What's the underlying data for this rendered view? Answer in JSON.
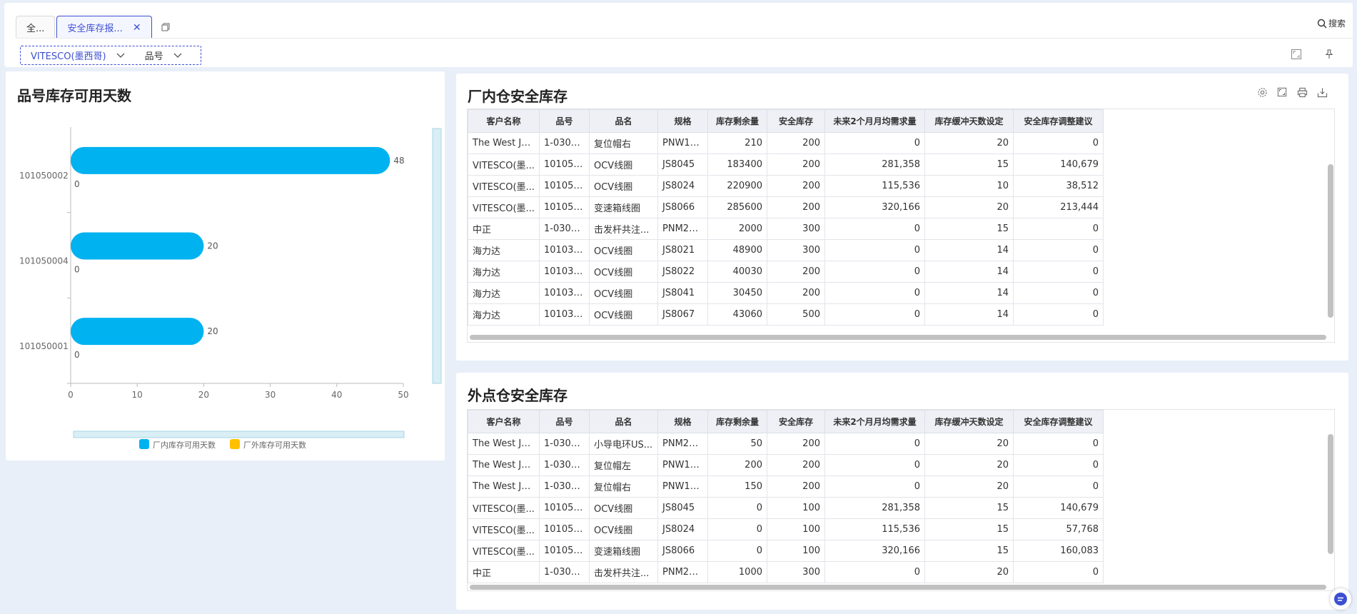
{
  "tabs": [
    {
      "label": "全..."
    },
    {
      "label": "安全库存报..."
    }
  ],
  "search_label": "搜索",
  "filters": [
    {
      "label": "VITESCO(墨西哥)"
    },
    {
      "label": "品号"
    }
  ],
  "chart_panel": {
    "title": "品号库存可用天数"
  },
  "chart_data": {
    "type": "bar",
    "orientation": "horizontal",
    "categories": [
      "101050002",
      "101050004",
      "101050001"
    ],
    "series": [
      {
        "name": "厂内库存可用天数",
        "values": [
          48,
          20,
          20
        ],
        "color": "#00b2f0"
      },
      {
        "name": "厂外库存可用天数",
        "values": [
          0,
          0,
          0
        ],
        "color": "#ffc000"
      }
    ],
    "xlim": [
      0,
      50
    ],
    "xticks": [
      0,
      10,
      20,
      30,
      40,
      50
    ],
    "legend_position": "bottom"
  },
  "table1": {
    "title": "厂内仓安全库存",
    "columns": [
      "客户名称",
      "品号",
      "品名",
      "规格",
      "库存剩余量",
      "安全库存",
      "未来2个月月均需求量",
      "库存缓冲天数设定",
      "安全库存调整建议"
    ],
    "rows": [
      [
        "The West Jo...",
        "1-0303...",
        "复位帽右",
        "PNW12...",
        "210",
        "200",
        "0",
        "20",
        "0"
      ],
      [
        "VITESCO(墨...",
        "101050...",
        "OCV线圈",
        "JS8045",
        "183400",
        "200",
        "281,358",
        "15",
        "140,679"
      ],
      [
        "VITESCO(墨...",
        "101050...",
        "OCV线圈",
        "JS8024",
        "220900",
        "200",
        "115,536",
        "10",
        "38,512"
      ],
      [
        "VITESCO(墨...",
        "101050...",
        "变速箱线圈",
        "JS8066",
        "285600",
        "200",
        "320,166",
        "20",
        "213,444"
      ],
      [
        "中正",
        "1-0303...",
        "击发杆共注...",
        "PNM20...",
        "2000",
        "300",
        "0",
        "15",
        "0"
      ],
      [
        "海力达",
        "101030...",
        "OCV线圈",
        "JS8021",
        "48900",
        "300",
        "0",
        "14",
        "0"
      ],
      [
        "海力达",
        "101030...",
        "OCV线圈",
        "JS8022",
        "40030",
        "200",
        "0",
        "14",
        "0"
      ],
      [
        "海力达",
        "101030...",
        "OCV线圈",
        "JS8041",
        "30450",
        "200",
        "0",
        "14",
        "0"
      ],
      [
        "海力达",
        "101030...",
        "OCV线圈",
        "JS8067",
        "43060",
        "500",
        "0",
        "14",
        "0"
      ]
    ]
  },
  "table2": {
    "title": "外点仓安全库存",
    "columns": [
      "客户名称",
      "品号",
      "品名",
      "规格",
      "库存剩余量",
      "安全库存",
      "未来2个月月均需求量",
      "库存缓冲天数设定",
      "安全库存调整建议"
    ],
    "rows": [
      [
        "The West Jo...",
        "1-0302...",
        "小导电环US...",
        "PNM21...",
        "50",
        "200",
        "0",
        "20",
        "0"
      ],
      [
        "The West Jo...",
        "1-0303...",
        "复位帽左",
        "PNW12...",
        "200",
        "200",
        "0",
        "20",
        "0"
      ],
      [
        "The West Jo...",
        "1-0303...",
        "复位帽右",
        "PNW12...",
        "150",
        "200",
        "0",
        "20",
        "0"
      ],
      [
        "VITESCO(墨...",
        "101050...",
        "OCV线圈",
        "JS8045",
        "0",
        "100",
        "281,358",
        "15",
        "140,679"
      ],
      [
        "VITESCO(墨...",
        "101050...",
        "OCV线圈",
        "JS8024",
        "0",
        "100",
        "115,536",
        "15",
        "57,768"
      ],
      [
        "VITESCO(墨...",
        "101050...",
        "变速箱线圈",
        "JS8066",
        "0",
        "100",
        "320,166",
        "15",
        "160,083"
      ],
      [
        "中正",
        "1-0303...",
        "击发杆共注...",
        "PNM20...",
        "1000",
        "300",
        "0",
        "20",
        "0"
      ]
    ]
  }
}
